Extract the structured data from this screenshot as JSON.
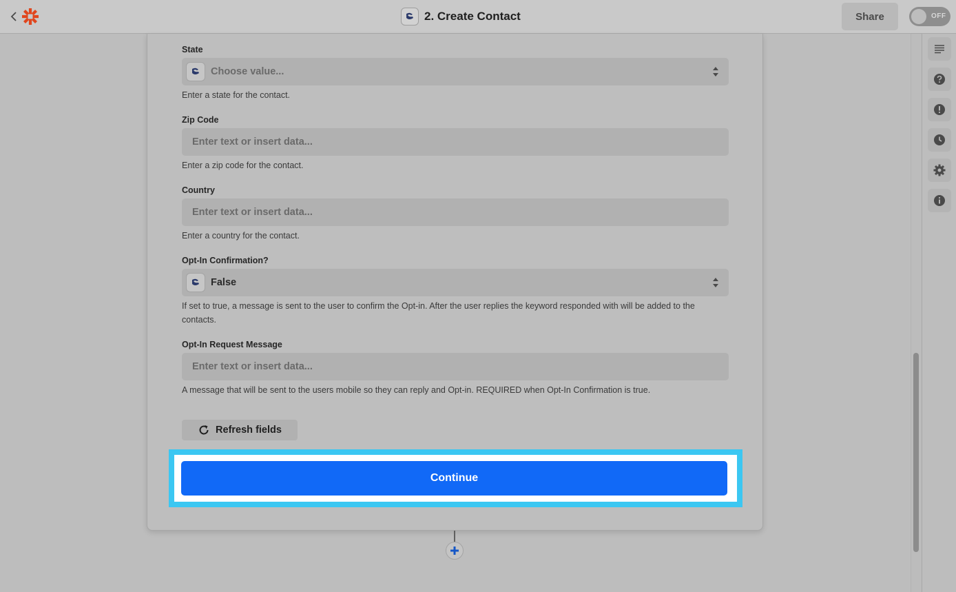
{
  "header": {
    "title": "2. Create Contact",
    "share_label": "Share",
    "toggle_label": "OFF",
    "back_icon": "chevron-left-icon",
    "logo_icon": "zapier-logo-icon",
    "app_icon": "app-logo-icon"
  },
  "fields": {
    "state": {
      "label": "State",
      "placeholder": "Choose value...",
      "help": "Enter a state for the contact."
    },
    "zip": {
      "label": "Zip Code",
      "placeholder": "Enter text or insert data...",
      "help": "Enter a zip code for the contact."
    },
    "country": {
      "label": "Country",
      "placeholder": "Enter text or insert data...",
      "help": "Enter a country for the contact."
    },
    "optin_confirm": {
      "label": "Opt-In Confirmation?",
      "value": "False",
      "help": "If set to true, a message is sent to the user to confirm the Opt-in. After the user replies the keyword responded with will be added to the contacts."
    },
    "optin_message": {
      "label": "Opt-In Request Message",
      "placeholder": "Enter text or insert data...",
      "help": "A message that will be sent to the users mobile so they can reply and Opt-in. REQUIRED when Opt-In Confirmation is true."
    }
  },
  "actions": {
    "refresh_label": "Refresh fields",
    "continue_label": "Continue"
  },
  "rail": {
    "icons": [
      "outline-icon",
      "help-icon",
      "alert-icon",
      "history-icon",
      "settings-icon",
      "info-icon"
    ]
  },
  "colors": {
    "primary": "#1169f7",
    "highlight": "#3bc7f2",
    "brand": "#ff4a00"
  }
}
